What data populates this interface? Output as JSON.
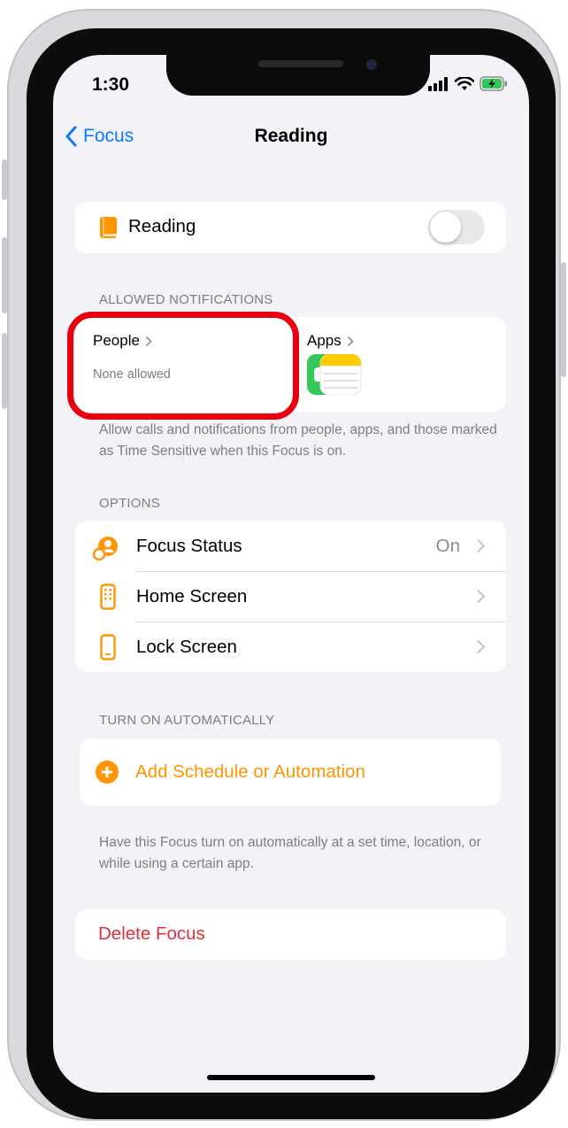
{
  "status_bar": {
    "time": "1:30"
  },
  "nav": {
    "back_label": "Focus",
    "title": "Reading"
  },
  "focus_toggle": {
    "label": "Reading",
    "enabled": false
  },
  "allowed_notifications": {
    "header": "ALLOWED NOTIFICATIONS",
    "people": {
      "label": "People",
      "value": "None allowed"
    },
    "apps": {
      "label": "Apps",
      "icons": [
        "facetime-icon",
        "notes-icon"
      ]
    },
    "footer": "Allow calls and notifications from people, apps, and those marked as Time Sensitive when this Focus is on."
  },
  "options": {
    "header": "OPTIONS",
    "items": [
      {
        "label": "Focus Status",
        "value": "On",
        "icon": "focus-status-icon"
      },
      {
        "label": "Home Screen",
        "value": "",
        "icon": "home-screen-icon"
      },
      {
        "label": "Lock Screen",
        "value": "",
        "icon": "lock-screen-icon"
      }
    ]
  },
  "automation": {
    "header": "TURN ON AUTOMATICALLY",
    "add_label": "Add Schedule or Automation",
    "footer": "Have this Focus turn on automatically at a set time, location, or while using a certain app."
  },
  "delete": {
    "label": "Delete Focus"
  },
  "colors": {
    "accent": "#ff9500",
    "link": "#0a7aff",
    "destructive": "#e0303a",
    "highlight": "#e8000f"
  }
}
